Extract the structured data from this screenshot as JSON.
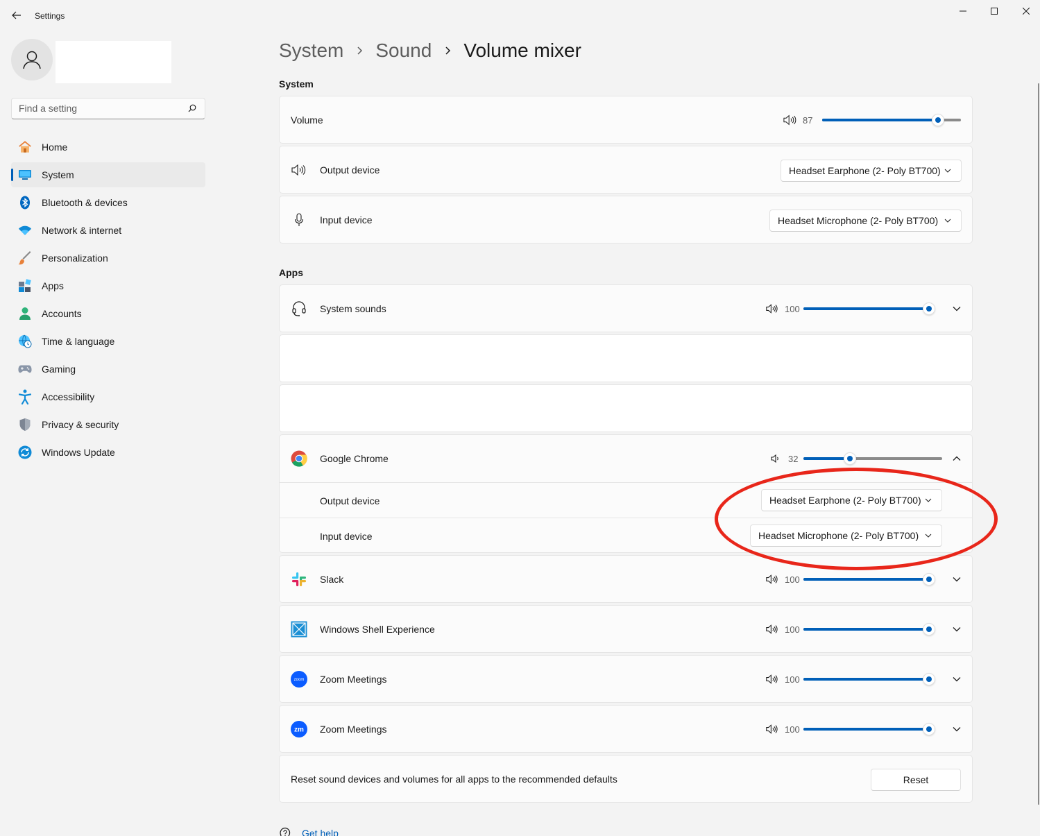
{
  "window": {
    "title": "Settings",
    "controls": [
      "minimize",
      "maximize",
      "close"
    ]
  },
  "sidebar": {
    "search_placeholder": "Find a setting",
    "items": [
      {
        "label": "Home",
        "icon": "home-icon",
        "active": false
      },
      {
        "label": "System",
        "icon": "system-icon",
        "active": true
      },
      {
        "label": "Bluetooth & devices",
        "icon": "bluetooth-icon",
        "active": false
      },
      {
        "label": "Network & internet",
        "icon": "wifi-icon",
        "active": false
      },
      {
        "label": "Personalization",
        "icon": "brush-icon",
        "active": false
      },
      {
        "label": "Apps",
        "icon": "apps-icon",
        "active": false
      },
      {
        "label": "Accounts",
        "icon": "person-icon",
        "active": false
      },
      {
        "label": "Time & language",
        "icon": "globe-clock-icon",
        "active": false
      },
      {
        "label": "Gaming",
        "icon": "gamepad-icon",
        "active": false
      },
      {
        "label": "Accessibility",
        "icon": "accessibility-icon",
        "active": false
      },
      {
        "label": "Privacy & security",
        "icon": "shield-icon",
        "active": false
      },
      {
        "label": "Windows Update",
        "icon": "update-icon",
        "active": false
      }
    ]
  },
  "breadcrumb": {
    "items": [
      "System",
      "Sound"
    ],
    "current": "Volume mixer"
  },
  "system_section": {
    "label": "System",
    "volume": {
      "label": "Volume",
      "value": 87
    },
    "output_device": {
      "label": "Output device",
      "value": "Headset Earphone (2- Poly BT700)"
    },
    "input_device": {
      "label": "Input device",
      "value": "Headset Microphone (2- Poly BT700)"
    }
  },
  "apps_section": {
    "label": "Apps",
    "system_sounds": {
      "label": "System sounds",
      "value": 100
    },
    "chrome": {
      "label": "Google Chrome",
      "value": 32,
      "output_label": "Output device",
      "output_value": "Headset Earphone (2- Poly BT700)",
      "input_label": "Input device",
      "input_value": "Headset Microphone (2- Poly BT700)"
    },
    "slack": {
      "label": "Slack",
      "value": 100
    },
    "shell": {
      "label": "Windows Shell Experience",
      "value": 100
    },
    "zoom1": {
      "label": "Zoom Meetings",
      "value": 100,
      "icon_text": "zoom"
    },
    "zoom2": {
      "label": "Zoom Meetings",
      "value": 100,
      "icon_text": "zm"
    }
  },
  "reset": {
    "text": "Reset sound devices and volumes for all apps to the recommended defaults",
    "button": "Reset"
  },
  "help": {
    "label": "Get help"
  },
  "colors": {
    "accent": "#005fb8",
    "annotation": "#e8261a"
  }
}
